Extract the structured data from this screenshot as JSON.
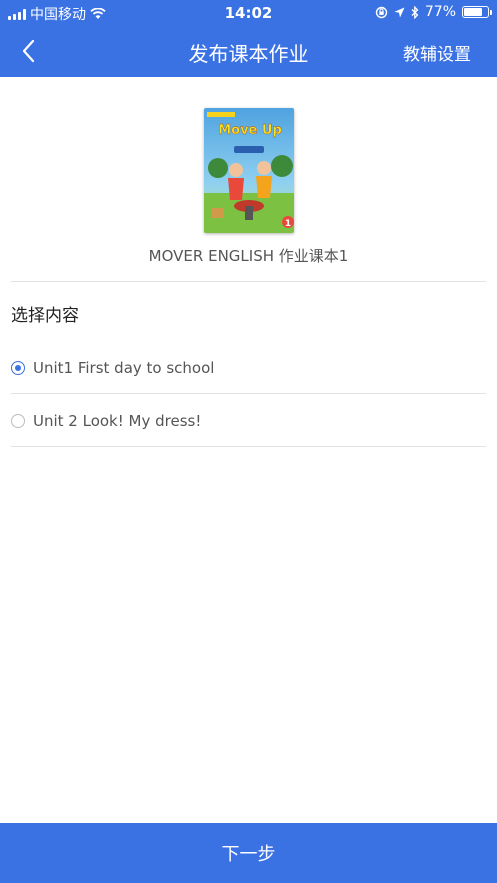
{
  "status_bar": {
    "carrier": "中国移动",
    "time": "14:02",
    "battery": "77%",
    "battery_level": 0.77,
    "icons": [
      "signal-icon",
      "wifi-icon",
      "rotation-lock-icon",
      "location-icon",
      "bluetooth-icon",
      "battery-icon"
    ]
  },
  "nav": {
    "back_icon": "chevron-left-icon",
    "title": "发布课本作业",
    "action": "教辅设置"
  },
  "book": {
    "cover_title": "Move Up",
    "cover_number": "1",
    "title": "MOVER ENGLISH 作业课本1"
  },
  "content": {
    "section_label": "选择内容",
    "options": [
      {
        "label": "Unit1 First day to school",
        "selected": true
      },
      {
        "label": "Unit 2 Look! My dress!",
        "selected": false
      }
    ]
  },
  "footer": {
    "next_label": "下一步"
  },
  "colors": {
    "primary": "#3a72e4",
    "divider": "#e2e2e2",
    "text_secondary": "#555555"
  }
}
